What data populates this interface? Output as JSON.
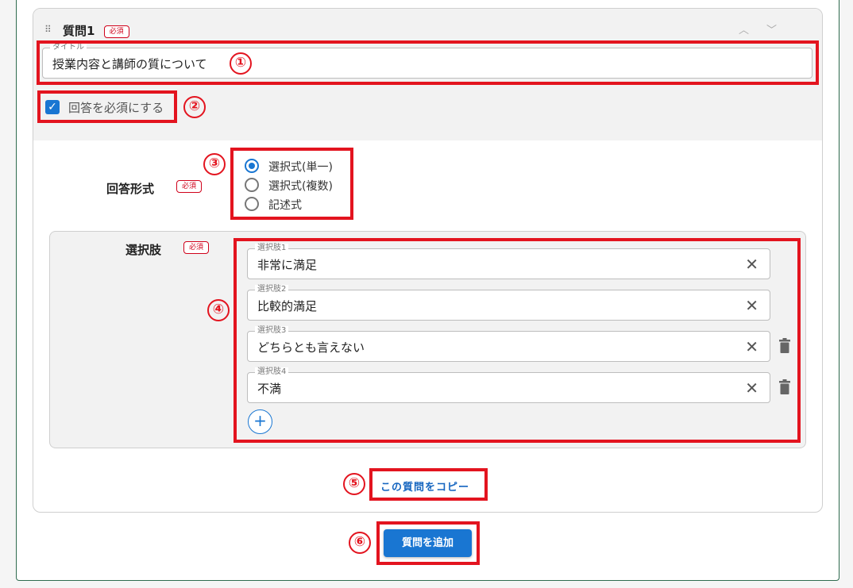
{
  "question": {
    "title": "質問1",
    "required_badge": "必須",
    "title_field": {
      "label": "タイトル",
      "value": "授業内容と講師の質について"
    },
    "required_checkbox": {
      "label": "回答を必須にする",
      "checked": true
    }
  },
  "answer_format": {
    "label": "回答形式",
    "required_badge": "必須",
    "options": [
      {
        "label": "選択式(単一)",
        "selected": true
      },
      {
        "label": "選択式(複数)",
        "selected": false
      },
      {
        "label": "記述式",
        "selected": false
      }
    ]
  },
  "choices": {
    "label": "選択肢",
    "required_badge": "必須",
    "items": [
      {
        "label": "選択肢1",
        "value": "非常に満足",
        "deletable": false
      },
      {
        "label": "選択肢2",
        "value": "比較的満足",
        "deletable": false
      },
      {
        "label": "選択肢3",
        "value": "どちらとも言えない",
        "deletable": true
      },
      {
        "label": "選択肢4",
        "value": "不満",
        "deletable": true
      }
    ]
  },
  "copy_question_link": "この質問をコピー",
  "add_question_button": "質問を追加",
  "annotations": [
    "①",
    "②",
    "③",
    "④",
    "⑤",
    "⑥"
  ],
  "colors": {
    "accent": "#1976d2",
    "annotation_red": "#e3141f",
    "required_red": "#d0021b"
  }
}
